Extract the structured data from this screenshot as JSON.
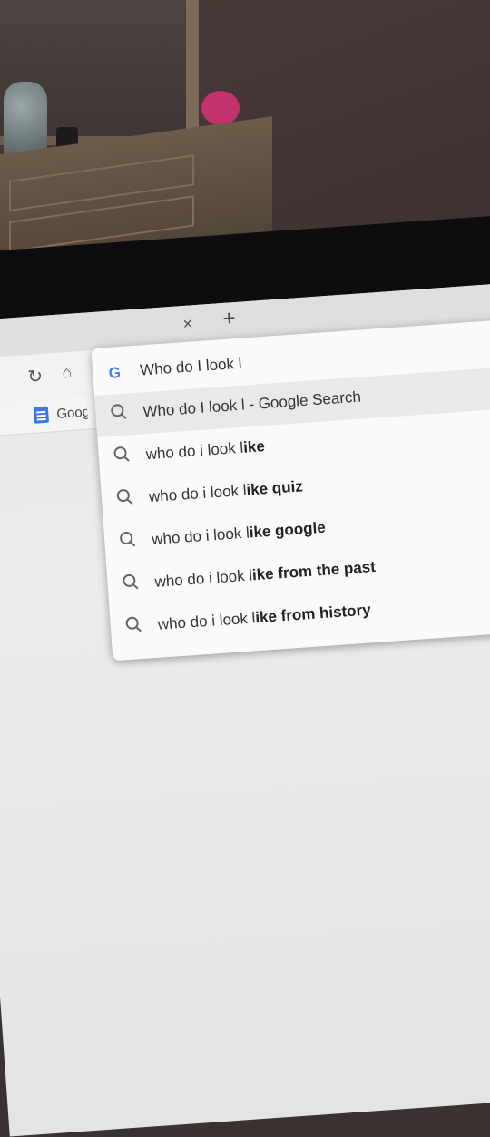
{
  "browser": {
    "tab_close": "×",
    "new_tab": "+",
    "reload_icon": "↻",
    "home_icon": "⌂"
  },
  "bookmarks": {
    "items": [
      {
        "label": "Goog"
      }
    ]
  },
  "omnibox": {
    "query": "Who do I look l",
    "suggestions": [
      {
        "prefix": "Who do I look l - Google Search",
        "bold": "",
        "selected": true
      },
      {
        "prefix": "who do i look l",
        "bold": "ike",
        "selected": false
      },
      {
        "prefix": "who do i look l",
        "bold": "ike quiz",
        "selected": false
      },
      {
        "prefix": "who do i look l",
        "bold": "ike google",
        "selected": false
      },
      {
        "prefix": "who do i look l",
        "bold": "ike from the past",
        "selected": false
      },
      {
        "prefix": "who do i look l",
        "bold": "ike from history",
        "selected": false
      }
    ]
  }
}
